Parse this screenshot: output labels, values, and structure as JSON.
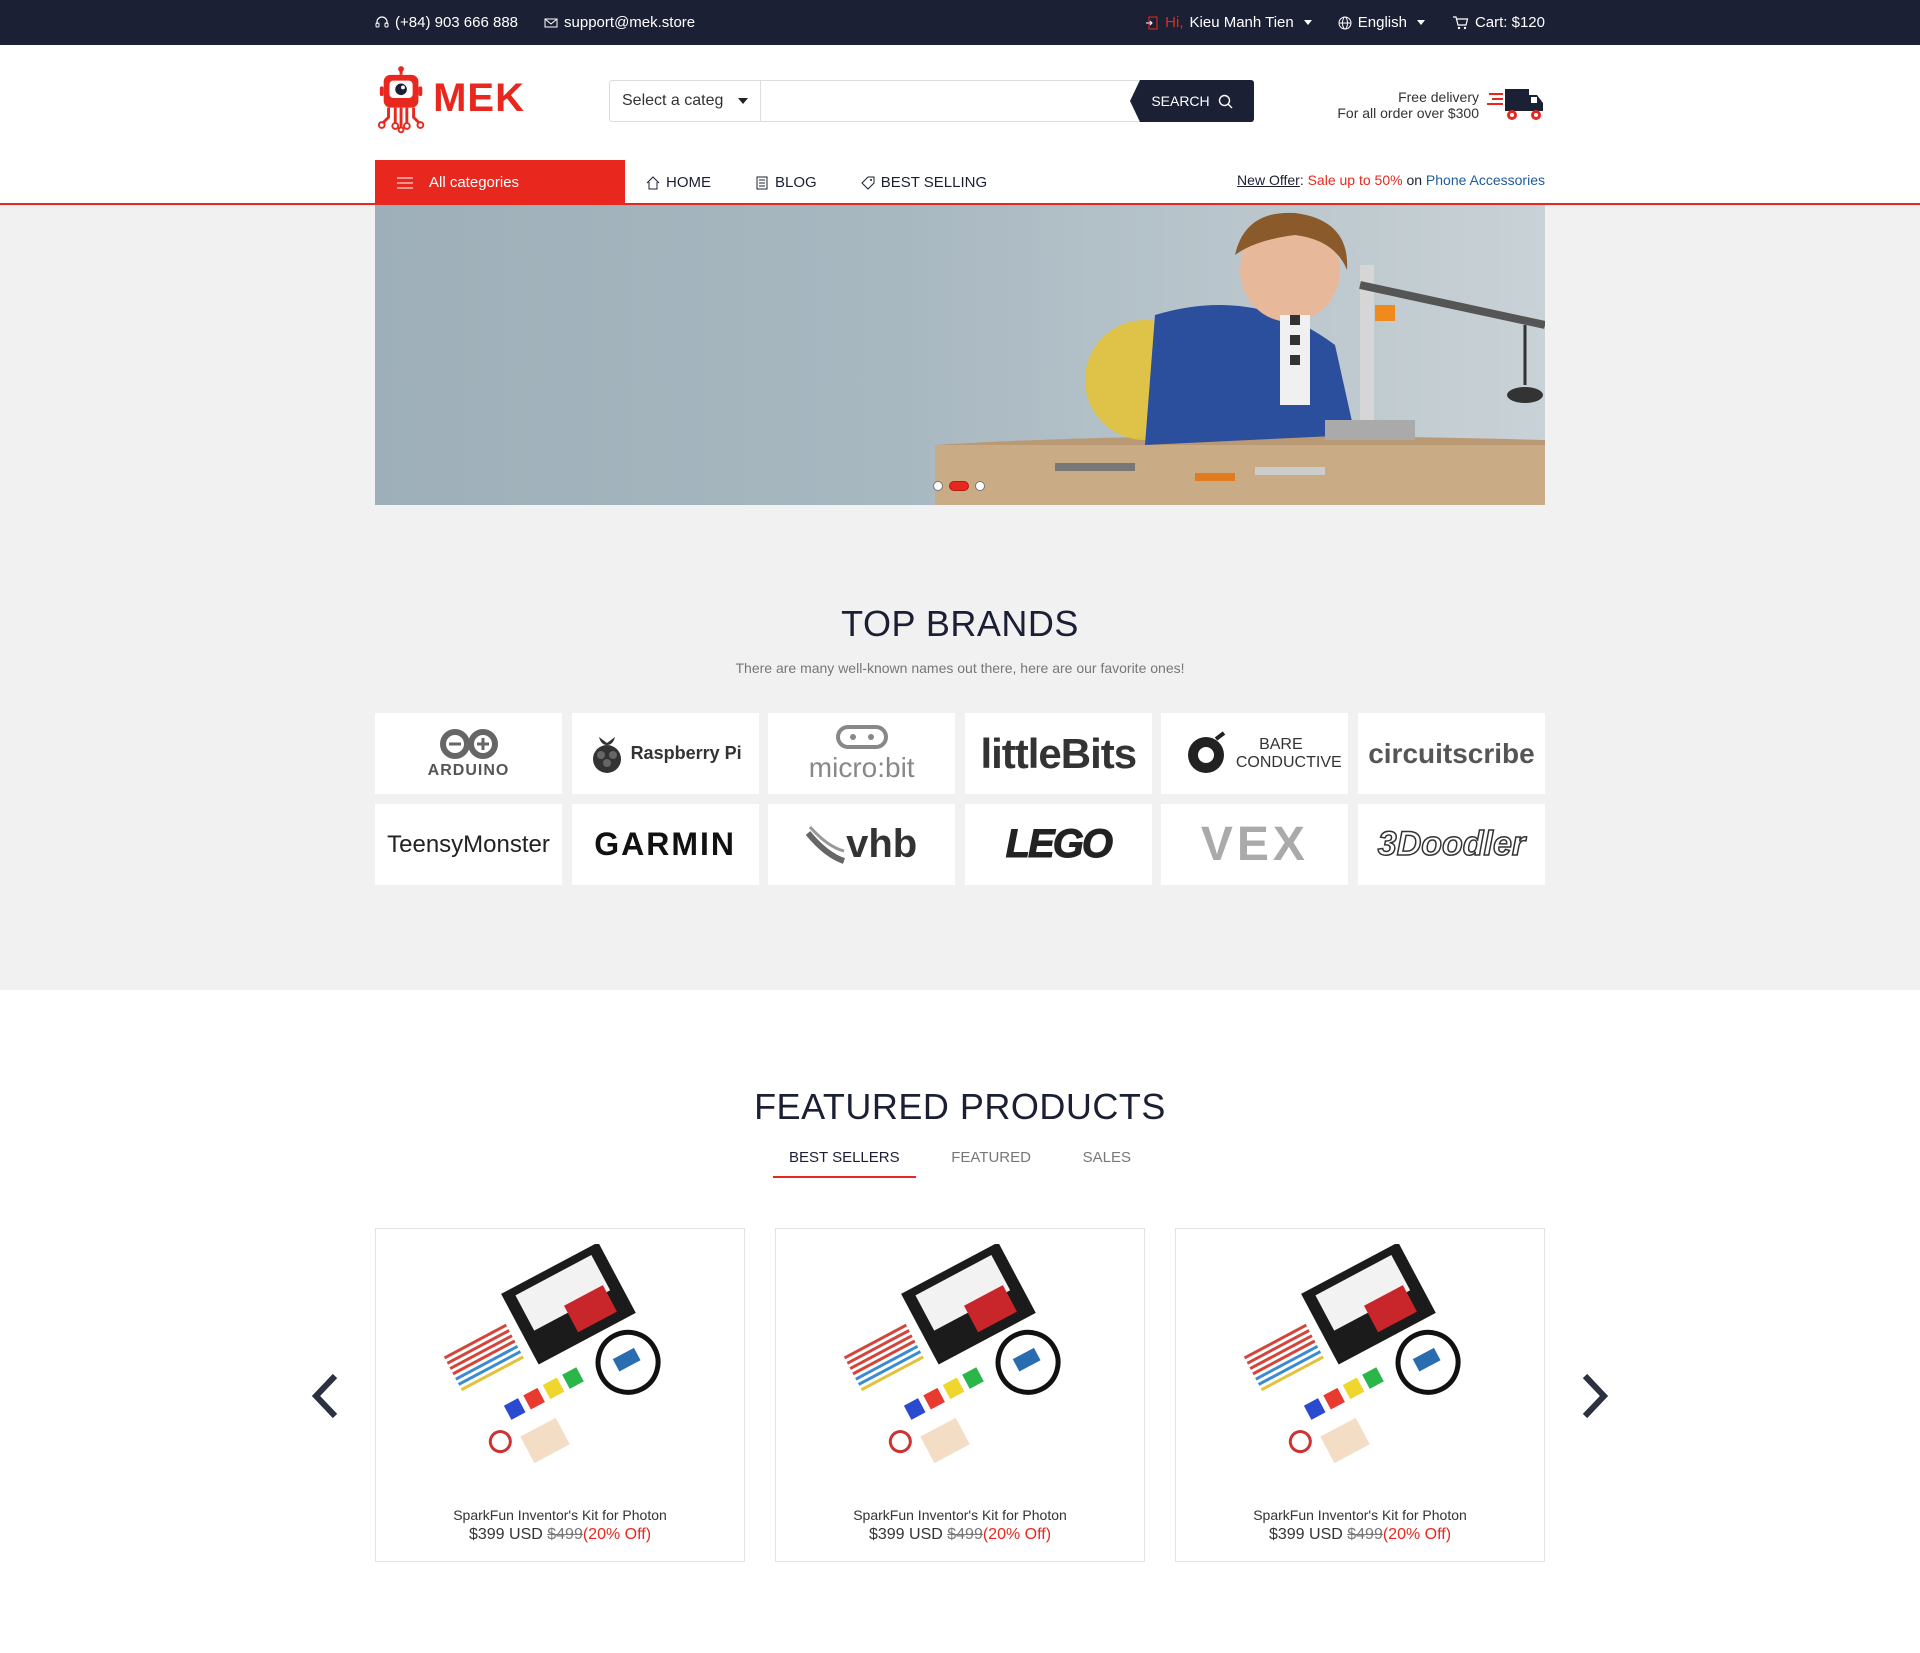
{
  "topbar": {
    "phone": "(+84) 903 666 888",
    "email": "support@mek.store",
    "greeting": "Hi,",
    "user": "Kieu Manh Tien",
    "language": "English",
    "cart": "Cart: $120"
  },
  "header": {
    "logo_text": "MEK",
    "search": {
      "category": "Select a categ",
      "placeholder": "",
      "button": "SEARCH"
    },
    "delivery": {
      "line1": "Free delivery",
      "line2": "For all order over $300"
    }
  },
  "nav": {
    "all_categories": "All categories",
    "items": [
      {
        "label": "HOME",
        "icon": "home-icon"
      },
      {
        "label": "BLOG",
        "icon": "blog-icon"
      },
      {
        "label": "BEST SELLING",
        "icon": "tag-icon"
      }
    ],
    "offer": {
      "label": "New Offer",
      "sep": ":",
      "sale": "Sale up to 50%",
      "on": "on",
      "category": "Phone Accessories"
    }
  },
  "hero": {
    "slides": 3,
    "active_slide": 2
  },
  "brands": {
    "title": "TOP BRANDS",
    "subtitle": "There are many well-known names out there, here are our favorite ones!",
    "items": [
      "ARDUINO",
      "Raspberry Pi",
      "micro:bit",
      "littleBits",
      "BARE CONDUCTIVE",
      "circuitscribe",
      "TeensyMonster",
      "GARMIN",
      "vhb",
      "LEGO",
      "VEX",
      "3Doodler"
    ]
  },
  "featured": {
    "title": "FEATURED PRODUCTS",
    "tabs": [
      "BEST SELLERS",
      "FEATURED",
      "SALES"
    ],
    "products": [
      {
        "name": "SparkFun Inventor's Kit for Photon",
        "price": "$399 USD",
        "old_price": "$499",
        "discount": "(20% Off)"
      },
      {
        "name": "SparkFun Inventor's Kit for Photon",
        "price": "$399 USD",
        "old_price": "$499",
        "discount": "(20% Off)"
      },
      {
        "name": "SparkFun Inventor's Kit for Photon",
        "price": "$399 USD",
        "old_price": "$499",
        "discount": "(20% Off)"
      }
    ]
  },
  "colors": {
    "accent": "#e8281e",
    "dark": "#1b2035",
    "band": "#f1f1f2"
  }
}
